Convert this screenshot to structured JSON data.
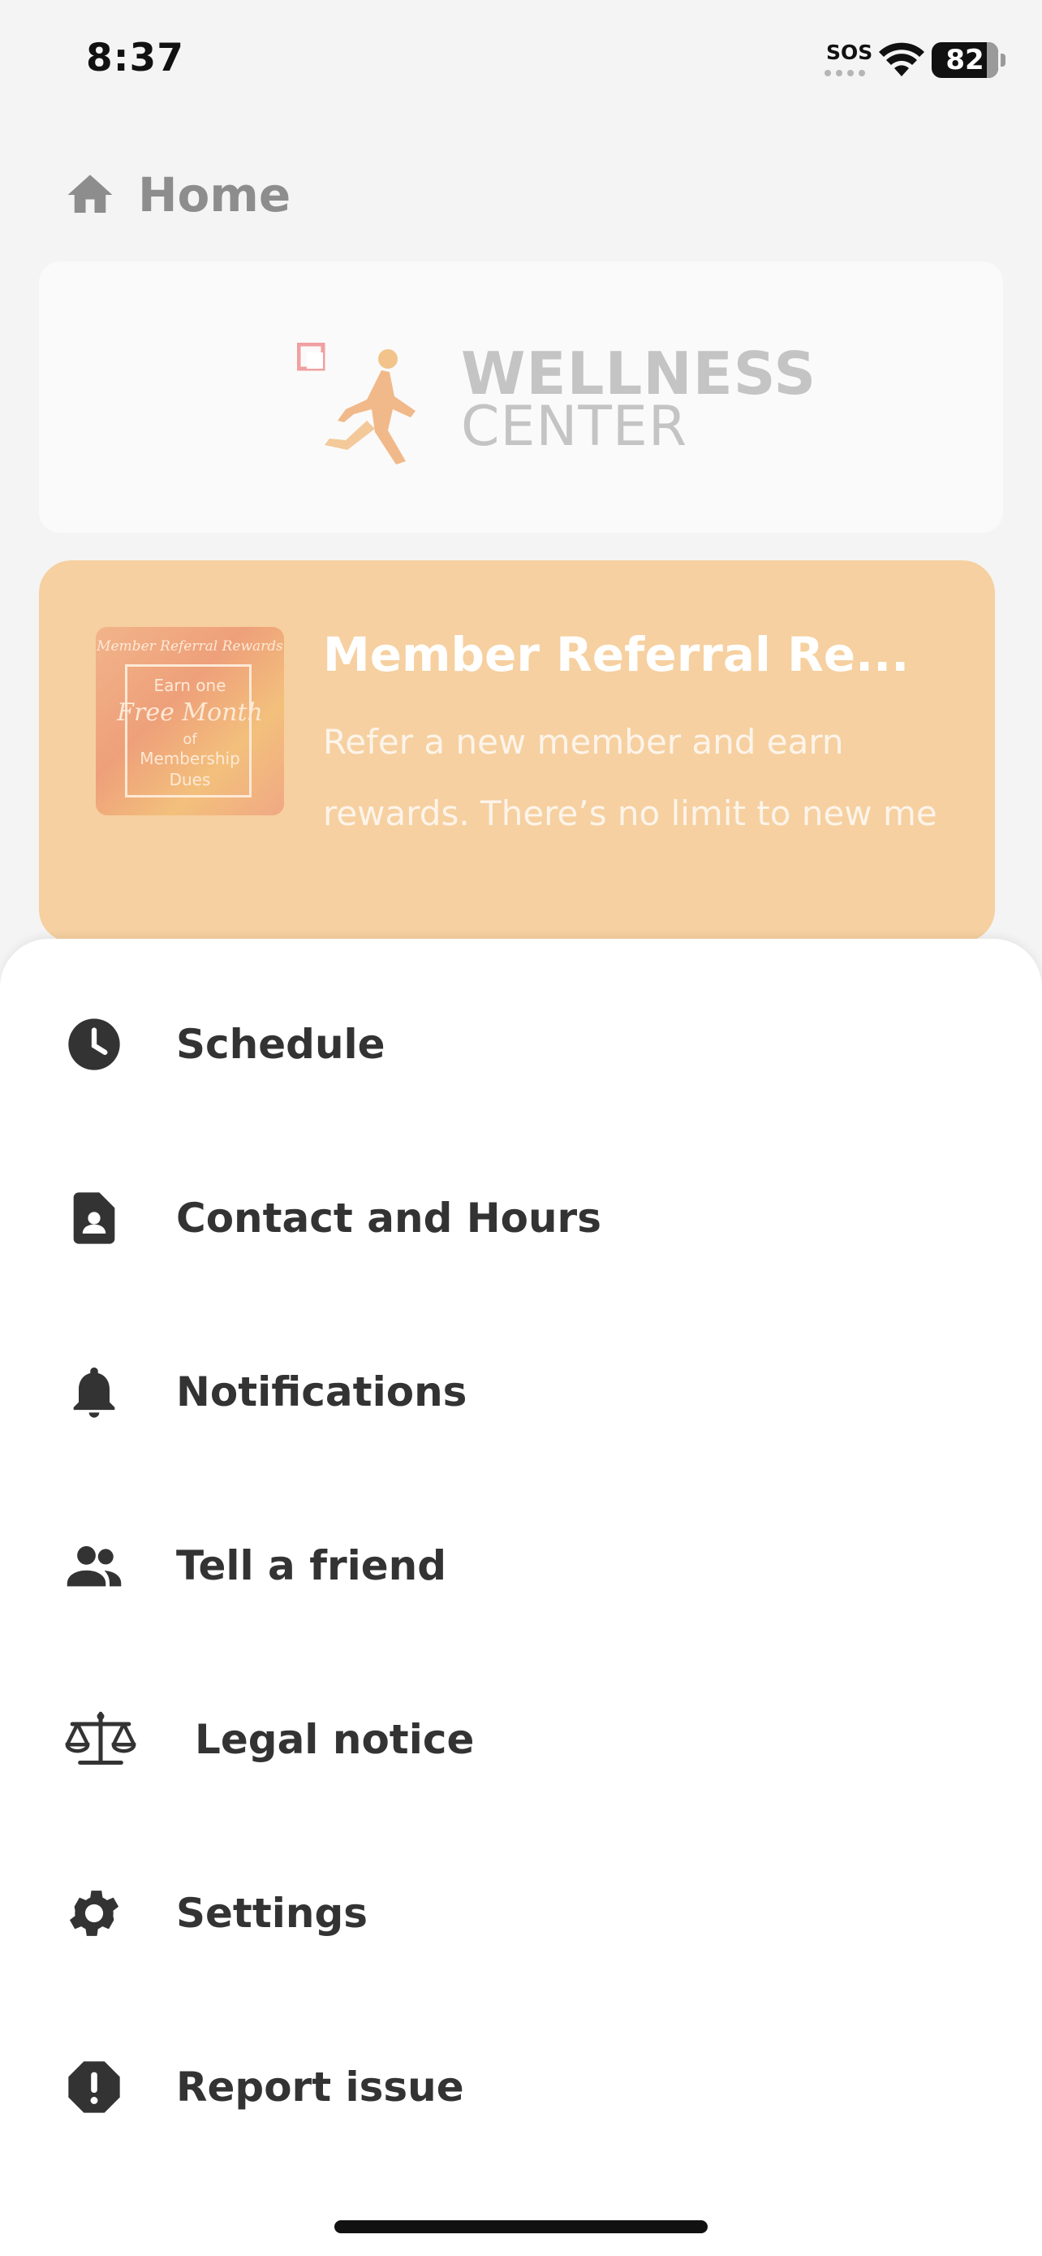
{
  "status_bar": {
    "time": "8:37",
    "sos": "SOS",
    "battery": "82",
    "icons": [
      "wifi-icon",
      "battery-icon"
    ]
  },
  "home": {
    "title": "Home",
    "icon": "home-icon",
    "logo": {
      "line1": "WELLNESS",
      "line2": "CENTER"
    },
    "promo": {
      "title": "Member Referral Re...",
      "text": "Refer a new member and earn rewards. There’s no limit to new me",
      "thumbnail": {
        "top": "Member Referral Rewards",
        "line1": "Earn one",
        "line2": "Free Month",
        "line3": "of",
        "line4": "Membership",
        "line5": "Dues"
      }
    }
  },
  "menu": {
    "items": [
      {
        "label": "Schedule",
        "icon": "clock-icon"
      },
      {
        "label": "Contact and Hours",
        "icon": "contact-card-icon"
      },
      {
        "label": "Notifications",
        "icon": "bell-icon"
      },
      {
        "label": "Tell a friend",
        "icon": "people-icon"
      },
      {
        "label": "Legal notice",
        "icon": "scales-icon"
      },
      {
        "label": "Settings",
        "icon": "gear-icon"
      },
      {
        "label": "Report issue",
        "icon": "alert-icon"
      }
    ]
  },
  "colors": {
    "sheet_background": "#ffffff",
    "menu_text": "#333333",
    "promo_background": "#f6d0a0",
    "dimmed_background": "#f4f4f4"
  }
}
